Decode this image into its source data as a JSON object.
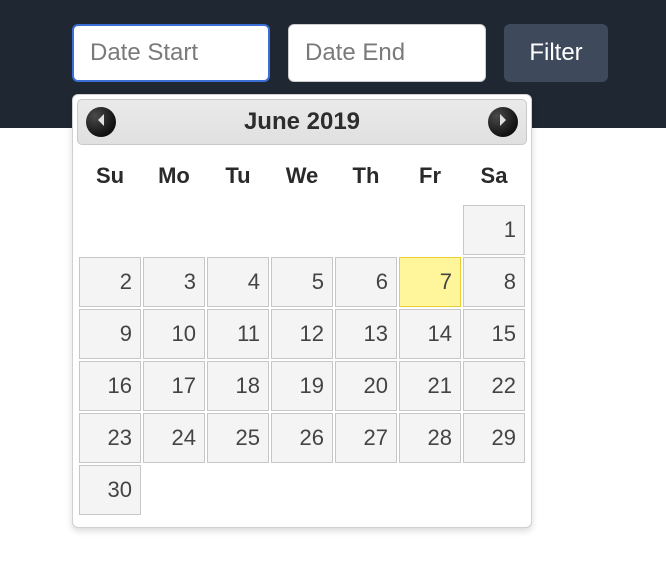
{
  "inputs": {
    "start_placeholder": "Date Start",
    "start_value": "",
    "end_placeholder": "Date End",
    "end_value": ""
  },
  "buttons": {
    "filter_label": "Filter"
  },
  "datepicker": {
    "title": "June 2019",
    "weekdays": [
      "Su",
      "Mo",
      "Tu",
      "We",
      "Th",
      "Fr",
      "Sa"
    ],
    "highlighted_day": 7,
    "weeks": [
      [
        null,
        null,
        null,
        null,
        null,
        null,
        1
      ],
      [
        2,
        3,
        4,
        5,
        6,
        7,
        8
      ],
      [
        9,
        10,
        11,
        12,
        13,
        14,
        15
      ],
      [
        16,
        17,
        18,
        19,
        20,
        21,
        22
      ],
      [
        23,
        24,
        25,
        26,
        27,
        28,
        29
      ],
      [
        30,
        null,
        null,
        null,
        null,
        null,
        null
      ]
    ]
  }
}
